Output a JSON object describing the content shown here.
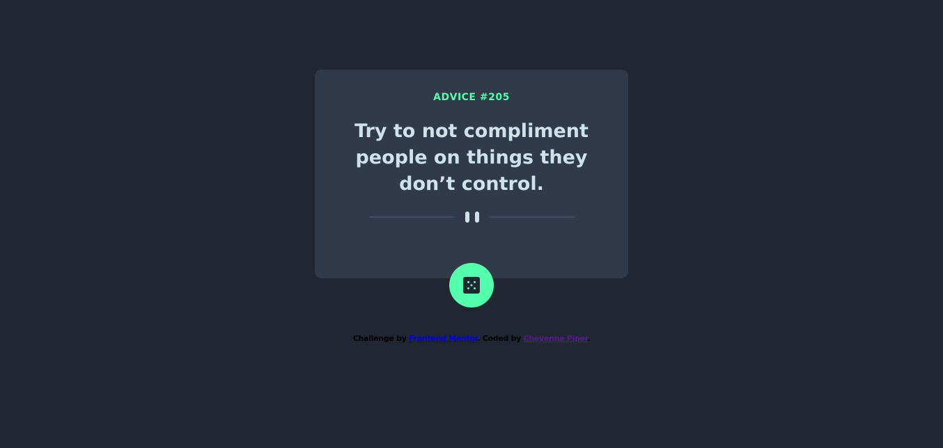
{
  "card": {
    "advice_id": "ADVICE #205",
    "quote": "Try to not compliment people on things they don’t control."
  },
  "dice_button": {
    "icon": "dice-icon"
  },
  "attribution": {
    "prefix": "Challenge by ",
    "challenge_link": "Frontend Mentor",
    "middle": ". Coded by ",
    "author_link": "Cheyenne Piper",
    "suffix": "."
  },
  "colors": {
    "background": "#202632",
    "card": "#313A49",
    "accent": "#53FFAA",
    "text": "#CEE3E9",
    "divider": "#4F5D74"
  }
}
